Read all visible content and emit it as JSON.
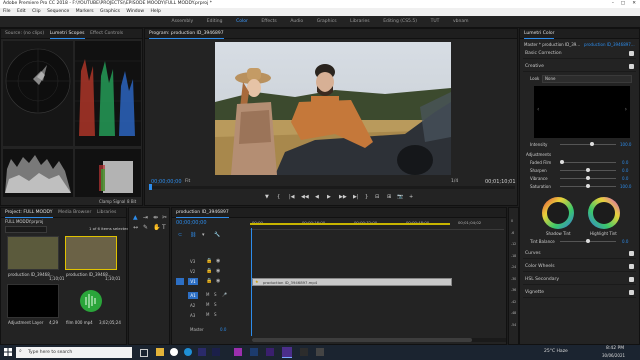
{
  "window": {
    "title": "Adobe Premiere Pro CC 2018 - F:\\YOUTUBE\\PROJECTS\\\\EPISODE MOODY\\FULL MODDY.prproj *",
    "controls": [
      "–",
      "□",
      "✕"
    ]
  },
  "menu": [
    "File",
    "Edit",
    "Clip",
    "Sequence",
    "Markers",
    "Graphics",
    "Window",
    "Help"
  ],
  "workspaces": [
    {
      "label": "Assembly",
      "active": false
    },
    {
      "label": "Editing",
      "active": false
    },
    {
      "label": "Color",
      "active": true
    },
    {
      "label": "Effects",
      "active": false
    },
    {
      "label": "Audio",
      "active": false
    },
    {
      "label": "Graphics",
      "active": false
    },
    {
      "label": "Libraries",
      "active": false
    },
    {
      "label": "Editing (CS5.5)",
      "active": false
    },
    {
      "label": "TUT",
      "active": false
    },
    {
      "label": "vbnam",
      "active": false
    }
  ],
  "source_panel": {
    "tabs": [
      "Source: (no clips)",
      "Lumetri Scopes",
      "Effect Controls"
    ],
    "active_tab": 1,
    "clamp_signal": "Clamp Signal",
    "bit_depth": "8 Bit"
  },
  "program_panel": {
    "title": "Program: production ID_3946897",
    "timecode_left": "00;00;00;00",
    "fit": "Fit",
    "fraction": "1/4",
    "timecode_right": "00;01;10;01",
    "transport": [
      "▼",
      "{",
      "|◀",
      "◀◀",
      "◀",
      "▶",
      "▶▶",
      "▶|",
      "}",
      "⊟",
      "⊞",
      "📷",
      "+"
    ]
  },
  "lumetri": {
    "tabs": [
      "Lumetri Color"
    ],
    "master": "Master * production ID_39...",
    "clip": "production ID_3946897...",
    "sections": [
      "Basic Correction",
      "Creative"
    ],
    "look_label": "Look",
    "look_value": "None",
    "intensity_label": "Intensity",
    "intensity_value": "100.0",
    "adjustments_label": "Adjustments",
    "sliders": [
      {
        "label": "Faded Film",
        "value": "0.0"
      },
      {
        "label": "Sharpen",
        "value": "0.0"
      },
      {
        "label": "Vibrance",
        "value": "0.0"
      },
      {
        "label": "Saturation",
        "value": "100.0"
      }
    ],
    "wheels": [
      "Shadow Tint",
      "Highlight Tint"
    ],
    "tint_balance_label": "Tint Balance",
    "tint_balance_value": "0.0",
    "more_sections": [
      "Curves",
      "Color Wheels",
      "HSL Secondary",
      "Vignette"
    ]
  },
  "project_panel": {
    "tabs": [
      "Project: FULL MODDY",
      "Media Browser",
      "Libraries"
    ],
    "path": "FULL MODDY.prproj",
    "items_count": "1 of 6 items selected",
    "items": [
      {
        "name": "production ID_39468...",
        "duration": "1;10;01"
      },
      {
        "name": "production ID_39468...",
        "duration": "1;10;01"
      },
      {
        "name": "Adjustment Layer",
        "duration": "4;29"
      },
      {
        "name": "film 000 mp4",
        "duration": "3;02;05;24"
      }
    ]
  },
  "timeline": {
    "tab": "production ID_3946897",
    "timecode": "00;00;00;00",
    "ruler": [
      "00;00",
      "00;00;16;00",
      "00;00;32;00",
      "00;00;48;00",
      "00;01;04;02"
    ],
    "tracks": [
      "V3",
      "V2",
      "V1",
      "A1",
      "A2",
      "A3",
      "Master"
    ],
    "master_value": "0.0",
    "clip_label": "production ID_3946897.mp4"
  },
  "audio_meter": {
    "scale": [
      "0",
      "-6",
      "-12",
      "-18",
      "-24",
      "-30",
      "-36",
      "-42",
      "-48",
      "-54"
    ]
  },
  "taskbar": {
    "search_placeholder": "Type here to search",
    "weather": "25°C Haze",
    "time": "8:42 PM",
    "date": "30/06/2021"
  }
}
